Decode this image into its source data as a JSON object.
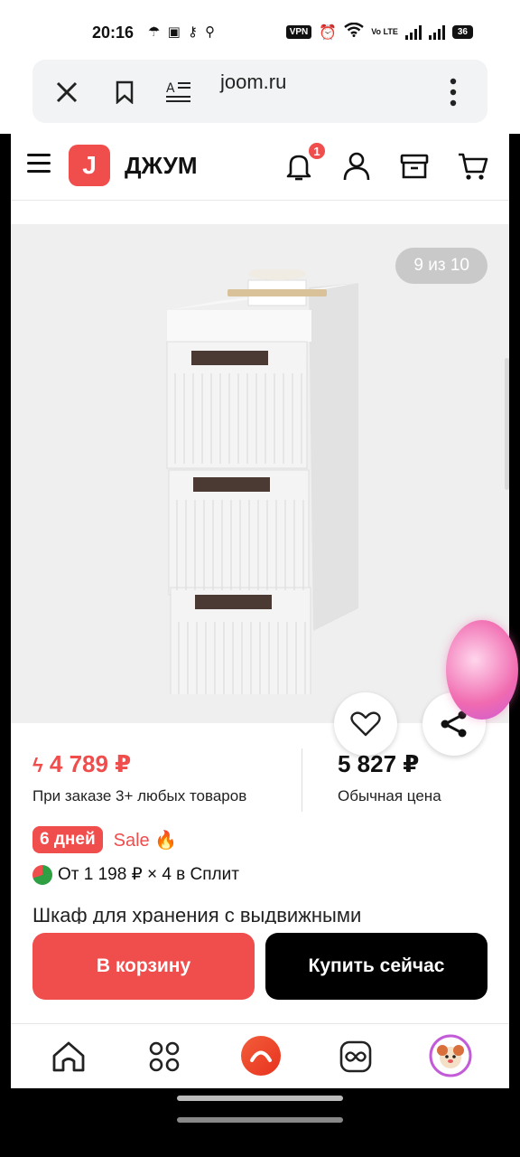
{
  "status_bar": {
    "time": "20:16",
    "left_icons": [
      "umbrella-icon",
      "do-not-disturb-icon",
      "key-icon",
      "search-icon"
    ],
    "vpn": "VPN",
    "signal_label": "Vo LTE",
    "battery": "36"
  },
  "browser": {
    "url": "joom.ru",
    "icons": [
      "close-icon",
      "bookmark-icon",
      "translate-icon",
      "more-icon"
    ]
  },
  "header": {
    "logo_letter": "J",
    "brand": "ДЖУМ",
    "notification_count": "1"
  },
  "gallery": {
    "counter": "9 из 10"
  },
  "pricing": {
    "sale_price": "4 789 ₽",
    "sale_note": "При заказе 3+ любых товаров",
    "regular_price": "5 827 ₽",
    "regular_note": "Обычная цена"
  },
  "promo": {
    "days": "6 дней",
    "sale": "Sale 🔥",
    "split": "От 1 198 ₽ × 4 в Сплит"
  },
  "product": {
    "title": "Шкаф для хранения с выдвижными"
  },
  "actions": {
    "cart": "В корзину",
    "buy_now": "Купить сейчас"
  },
  "colors": {
    "brand_red": "#f04d4d",
    "black_button": "#000000"
  }
}
